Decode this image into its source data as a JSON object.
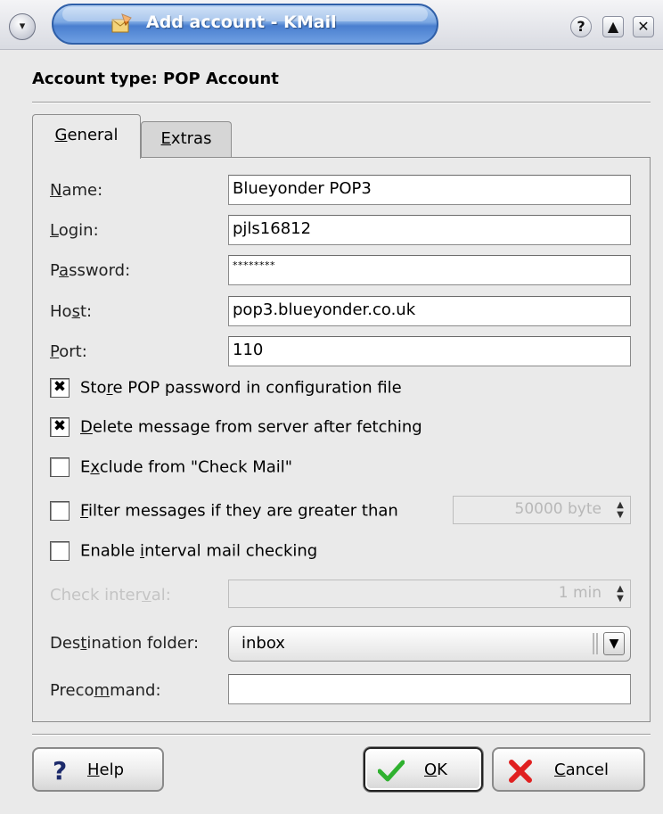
{
  "window": {
    "title": "Add account - KMail",
    "menu_glyph": "▾",
    "help_glyph": "?",
    "max_glyph": "▲",
    "close_glyph": "✕"
  },
  "header": {
    "account_type": "Account type: POP Account"
  },
  "tabs": [
    {
      "label": "General",
      "mnemonic": "G",
      "rest": "eneral",
      "selected": true
    },
    {
      "label": "Extras",
      "mnemonic": "E",
      "rest": "xtras",
      "selected": false
    }
  ],
  "form": {
    "name": {
      "pre": "",
      "mn": "N",
      "post": "ame:",
      "value": "Blueyonder POP3"
    },
    "login": {
      "pre": "",
      "mn": "L",
      "post": "ogin:",
      "value": "pjls16812"
    },
    "password": {
      "pre": "P",
      "mn": "a",
      "post": "ssword:",
      "value": "********"
    },
    "host": {
      "pre": "Ho",
      "mn": "s",
      "post": "t:",
      "value": "pop3.blueyonder.co.uk"
    },
    "port": {
      "pre": "",
      "mn": "P",
      "post": "ort:",
      "value": "110"
    }
  },
  "checks": {
    "store": {
      "checked": "✖",
      "pre": "Sto",
      "mn": "r",
      "post": "e POP password in configuration file"
    },
    "delete": {
      "checked": "✖",
      "pre": "",
      "mn": "D",
      "post": "elete message from server after fetching"
    },
    "exclude": {
      "checked": "",
      "pre": "E",
      "mn": "x",
      "post": "clude from \"Check Mail\""
    },
    "filter": {
      "checked": "",
      "pre": "",
      "mn": "F",
      "post": "ilter messages if they are greater than"
    },
    "interval": {
      "checked": "",
      "pre": "Enable ",
      "mn": "i",
      "post": "nterval mail checking"
    }
  },
  "filter_size": "50000 byte",
  "check_interval": {
    "pre": "Check inter",
    "mn": "v",
    "post": "al:",
    "value": "1 min"
  },
  "destination": {
    "pre": "Des",
    "mn": "t",
    "post": "ination folder:",
    "value": "inbox"
  },
  "precommand": {
    "pre": "Preco",
    "mn": "m",
    "post": "mand:",
    "value": ""
  },
  "buttons": {
    "help": {
      "mn": "H",
      "post": "elp"
    },
    "ok": {
      "mn": "O",
      "post": "K"
    },
    "cancel": {
      "mn": "C",
      "post": "ancel"
    }
  },
  "colors": {
    "title_bar_blue": "#4a7fcf",
    "ok_green": "#2fb12f",
    "cancel_red": "#e02020"
  }
}
